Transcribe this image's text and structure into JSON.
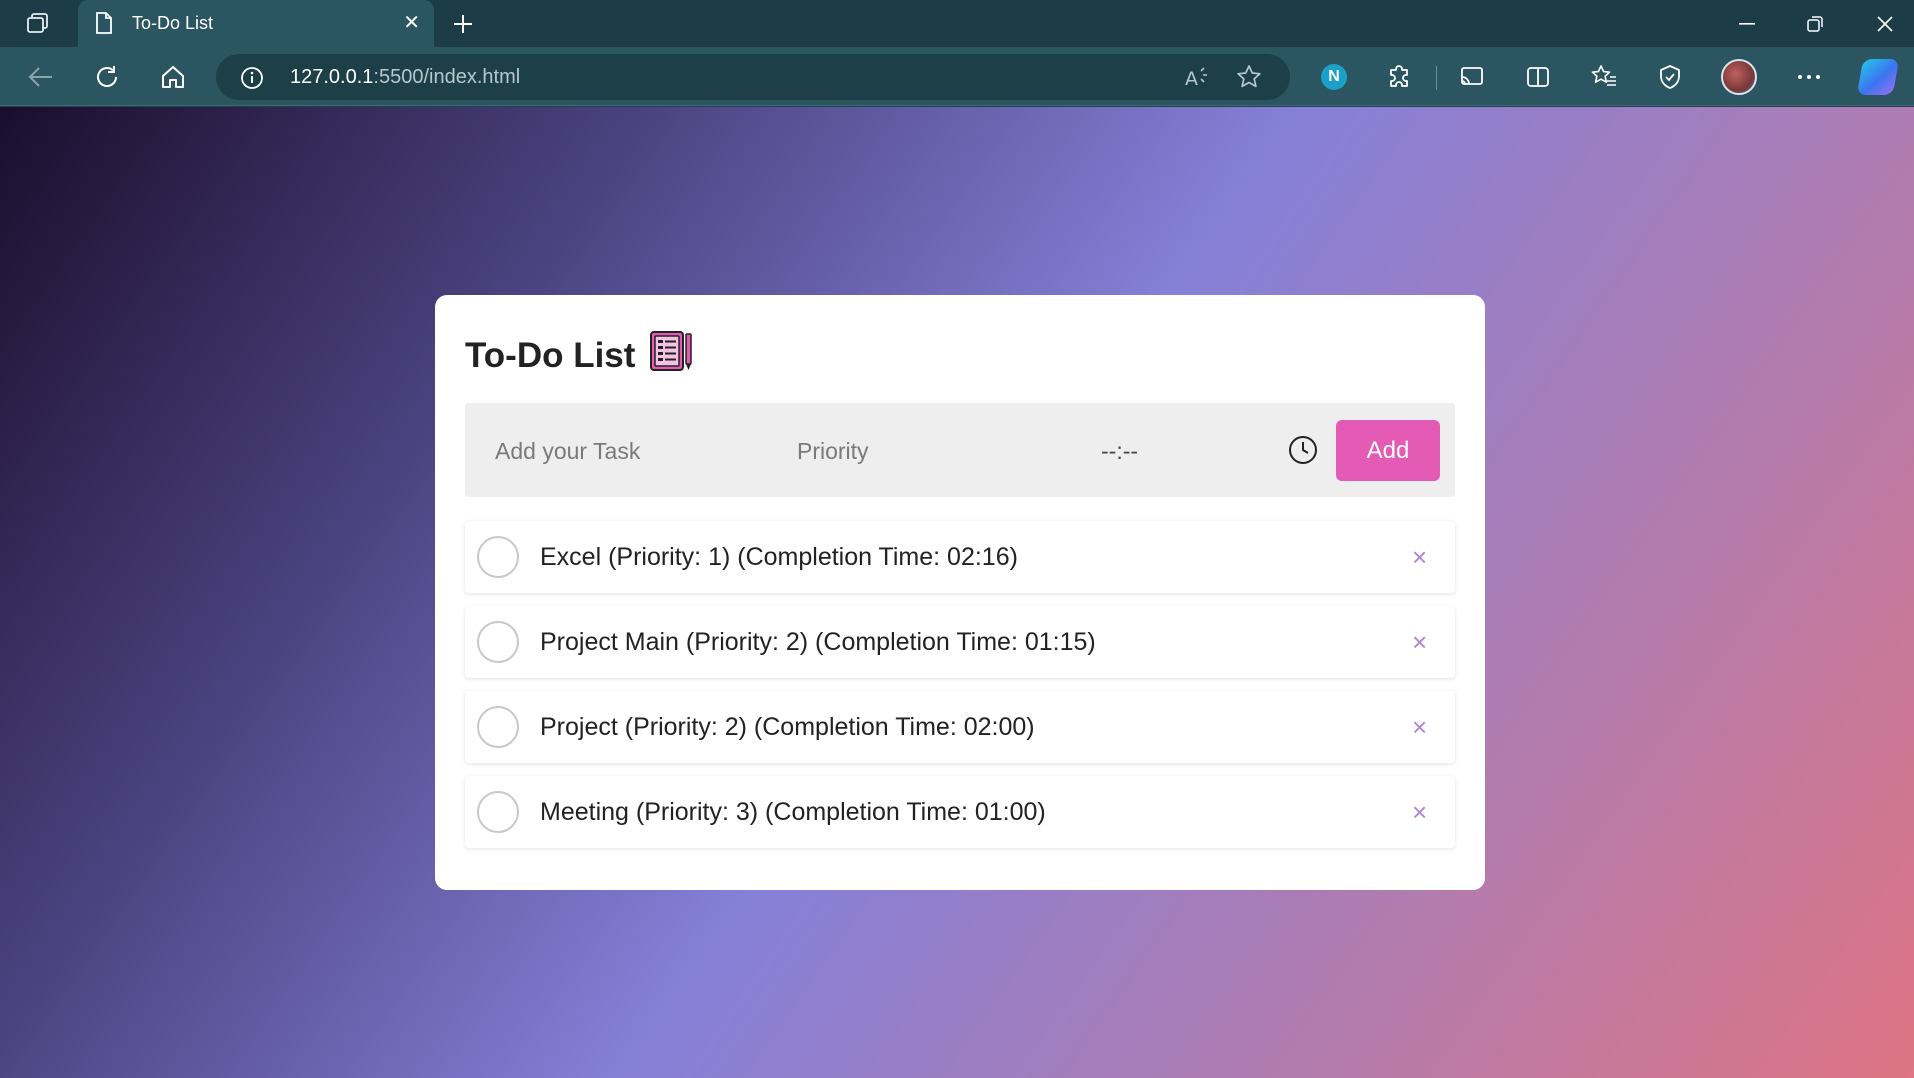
{
  "browser": {
    "tab_title": "To-Do List",
    "tab_close": "✕",
    "new_tab": "+",
    "url_host": "127.0.0.1",
    "url_rest": ":5500/index.html",
    "extension_badge": "N"
  },
  "app": {
    "title": "To-Do List",
    "task_placeholder": "Add your Task",
    "priority_placeholder": "Priority",
    "time_placeholder": "--:--",
    "add_label": "Add",
    "tasks": [
      {
        "text": "Excel (Priority: 1) (Completion Time: 02:16)",
        "delete": "×"
      },
      {
        "text": "Project Main (Priority: 2) (Completion Time: 01:15)",
        "delete": "×"
      },
      {
        "text": "Project (Priority: 2) (Completion Time: 02:00)",
        "delete": "×"
      },
      {
        "text": "Meeting (Priority: 3) (Completion Time: 01:00)",
        "delete": "×"
      }
    ]
  },
  "colors": {
    "accent": "#e35bb5",
    "delete": "#b383d4",
    "chrome": "#2b5560"
  }
}
